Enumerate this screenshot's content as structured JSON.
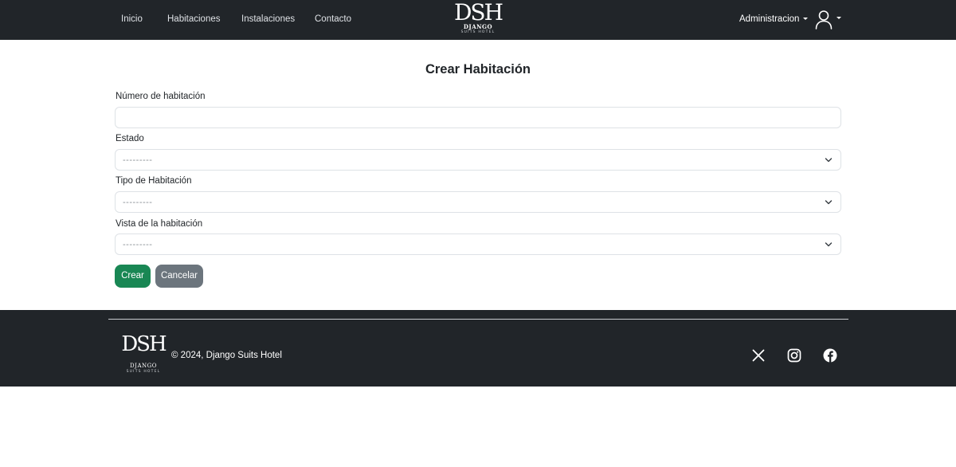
{
  "nav": {
    "links": [
      "Inicio",
      "Habitaciones",
      "Instalaciones",
      "Contacto"
    ],
    "brand": {
      "mark": "DSH",
      "name": "DJANGO",
      "tagline": "SUITS HOTEL"
    },
    "admin_label": "Administracion",
    "user_icon": "person-icon"
  },
  "form": {
    "title": "Crear Habitación",
    "fields": [
      {
        "label": "Número de habitación",
        "type": "text",
        "value": ""
      },
      {
        "label": "Estado",
        "type": "select",
        "selected": "---------"
      },
      {
        "label": "Tipo de Habitación",
        "type": "select",
        "selected": "---------"
      },
      {
        "label": "Vista de la habitación",
        "type": "select",
        "selected": "---------"
      }
    ],
    "submit_label": "Crear",
    "cancel_label": "Cancelar"
  },
  "footer": {
    "logo": {
      "mark": "DSH",
      "name": "DJANGO",
      "tagline": "SUITS HOTEL"
    },
    "copyright": "© 2024, Django Suits Hotel",
    "social": [
      "x-icon",
      "instagram-icon",
      "facebook-icon"
    ]
  },
  "colors": {
    "navbar_bg": "#212529",
    "success": "#198754",
    "secondary": "#6c757d",
    "border": "#dee2e6"
  }
}
